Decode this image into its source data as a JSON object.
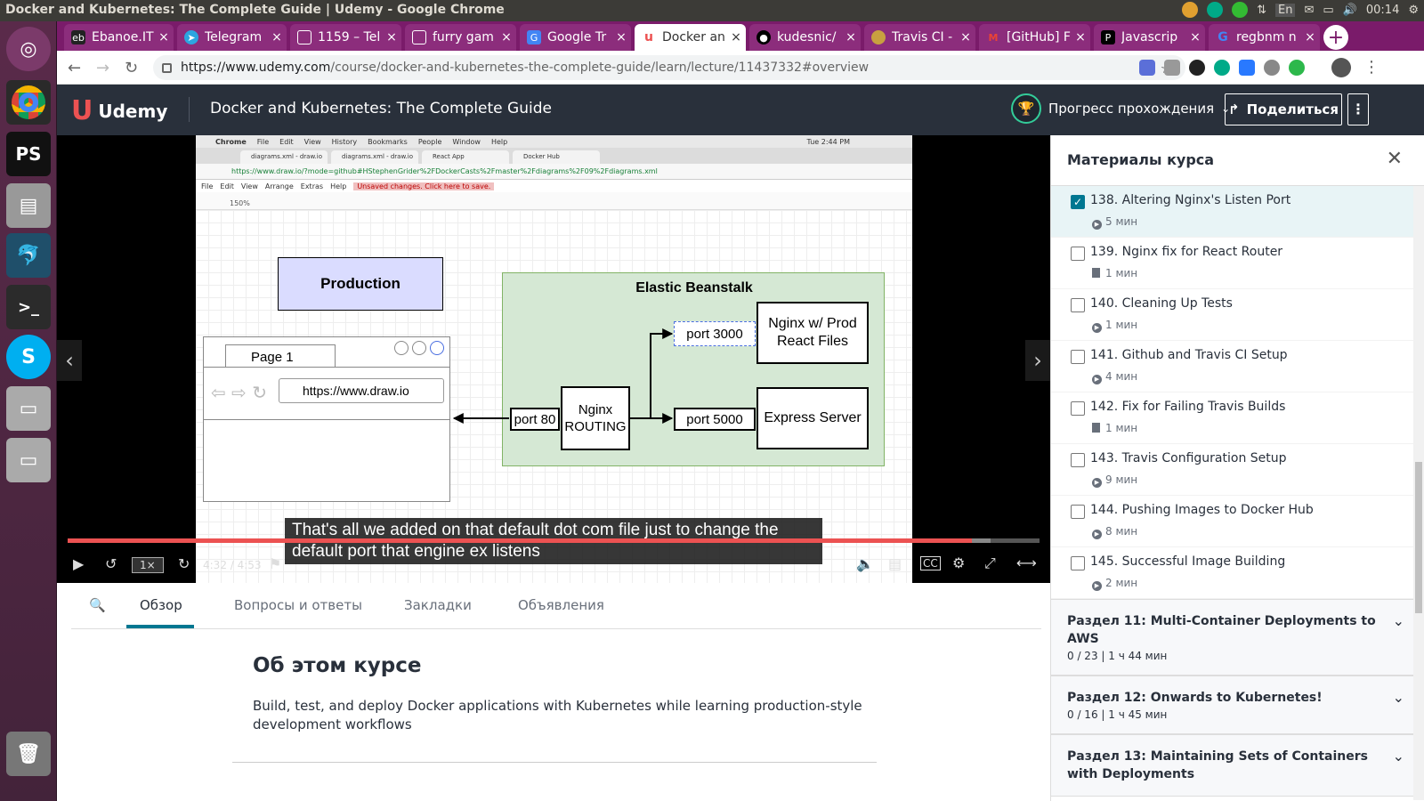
{
  "window_title": "Docker and Kubernetes: The Complete Guide | Udemy - Google Chrome",
  "tray": {
    "lang": "En",
    "time": "00:14"
  },
  "tabs": [
    {
      "label": "Ebanoe.IT",
      "fav": "eb"
    },
    {
      "label": "Telegram",
      "fav": "tg"
    },
    {
      "label": "1159 – Tel",
      "fav": "doc"
    },
    {
      "label": "furry gam",
      "fav": "doc"
    },
    {
      "label": "Google Tr",
      "fav": "gt"
    },
    {
      "label": "Docker an",
      "fav": "u"
    },
    {
      "label": "kudesnic/",
      "fav": "gh"
    },
    {
      "label": "Travis CI -",
      "fav": "tr"
    },
    {
      "label": "[GitHub] F",
      "fav": "m"
    },
    {
      "label": "Javascrip",
      "fav": "ps"
    },
    {
      "label": "regbnm n",
      "fav": "g"
    }
  ],
  "url": {
    "domain": "https://www.udemy.com",
    "path": "/course/docker-and-kubernetes-the-complete-guide/learn/lecture/11437332#overview"
  },
  "header": {
    "logo": "Udemy",
    "course_title": "Docker and Kubernetes: The Complete Guide",
    "progress_label": "Прогресс прохождения",
    "share_label": "Поделиться"
  },
  "video": {
    "mac_menu": [
      "Chrome",
      "File",
      "Edit",
      "View",
      "History",
      "Bookmarks",
      "People",
      "Window",
      "Help"
    ],
    "mac_clock": "Tue 2:44 PM",
    "browser_tabs": [
      "diagrams.xml - draw.io",
      "diagrams.xml - draw.io",
      "React App",
      "Docker Hub"
    ],
    "browser_url": "https://www.draw.io/?mode=github#HStephenGrider%2FDockerCasts%2Fmaster%2Fdiagrams%2F09%2Fdiagrams.xml",
    "drawio_menu": [
      "File",
      "Edit",
      "View",
      "Arrange",
      "Extras",
      "Help"
    ],
    "unsaved": "Unsaved changes. Click here to save.",
    "zoom": "150%",
    "diagram": {
      "production": "Production",
      "page_tab": "Page 1",
      "page_url": "https://www.draw.io",
      "eb_title": "Elastic Beanstalk",
      "port80": "port 80",
      "nginx_routing": "Nginx ROUTING",
      "port3000": "port 3000",
      "port5000": "port 5000",
      "nginx_prod": "Nginx w/ Prod React Files",
      "express": "Express Server"
    },
    "caption": "That's all we added on that default dot com file just to change the default port that engine ex listens",
    "time": "4:32 / 4:53",
    "speed": "1×",
    "progress_fraction": 0.93
  },
  "lower_tabs": [
    "Обзор",
    "Вопросы и ответы",
    "Закладки",
    "Объявления"
  ],
  "about": {
    "title": "Об этом курсе",
    "text": "Build, test, and deploy Docker applications with Kubernetes while learning production-style development workflows"
  },
  "sidebar": {
    "title": "Материалы курса",
    "lectures": [
      {
        "title": "138. Altering Nginx's Listen Port",
        "dur": "5 мин",
        "type": "video",
        "done": true,
        "current": true
      },
      {
        "title": "139. Nginx fix for React Router",
        "dur": "1 мин",
        "type": "doc",
        "done": false
      },
      {
        "title": "140. Cleaning Up Tests",
        "dur": "1 мин",
        "type": "video",
        "done": false
      },
      {
        "title": "141. Github and Travis CI Setup",
        "dur": "4 мин",
        "type": "video",
        "done": false
      },
      {
        "title": "142. Fix for Failing Travis Builds",
        "dur": "1 мин",
        "type": "doc",
        "done": false
      },
      {
        "title": "143. Travis Configuration Setup",
        "dur": "9 мин",
        "type": "video",
        "done": false
      },
      {
        "title": "144. Pushing Images to Docker Hub",
        "dur": "8 мин",
        "type": "video",
        "done": false
      },
      {
        "title": "145. Successful Image Building",
        "dur": "2 мин",
        "type": "video",
        "done": false
      }
    ],
    "sections": [
      {
        "title": "Раздел 11: Multi-Container Deployments to AWS",
        "meta": "0 / 23 | 1 ч 44 мин"
      },
      {
        "title": "Раздел 12: Onwards to Kubernetes!",
        "meta": "0 / 16 | 1 ч 45 мин"
      },
      {
        "title": "Раздел 13: Maintaining Sets of Containers with Deployments",
        "meta": ""
      }
    ]
  }
}
